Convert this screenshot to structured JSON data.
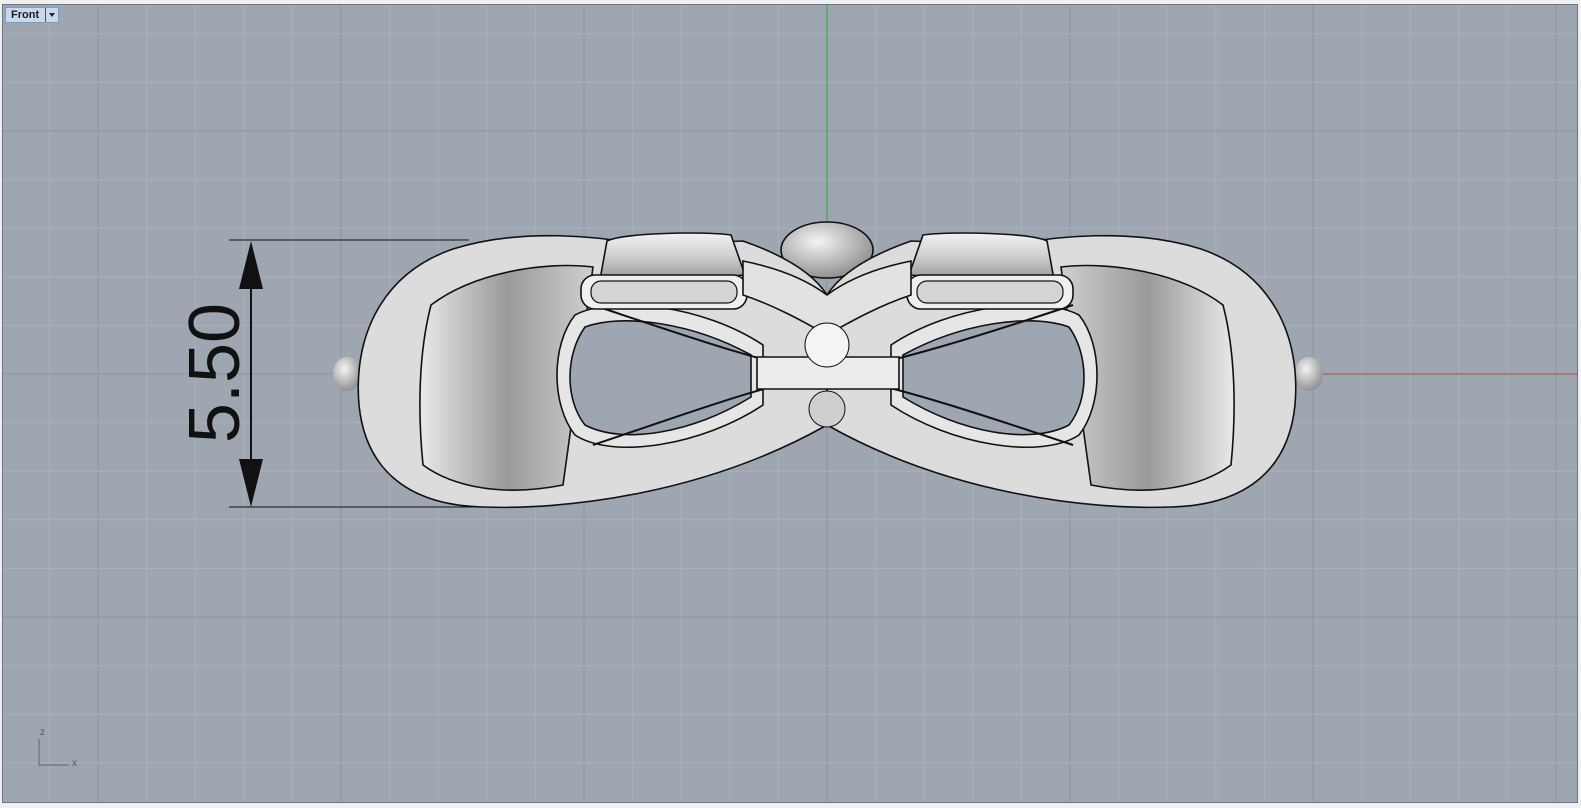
{
  "viewport": {
    "name": "Front"
  },
  "dimension": {
    "value": "5.50"
  },
  "axis_widget": {
    "vertical": "z",
    "horizontal": "x"
  },
  "colors": {
    "background": "#9ea7b1",
    "grid_minor": "#a9b1ba",
    "grid_major": "#8c959f",
    "x_axis": "#b34a4a",
    "z_axis": "#2fa52f",
    "model": "#d8d8d8"
  }
}
